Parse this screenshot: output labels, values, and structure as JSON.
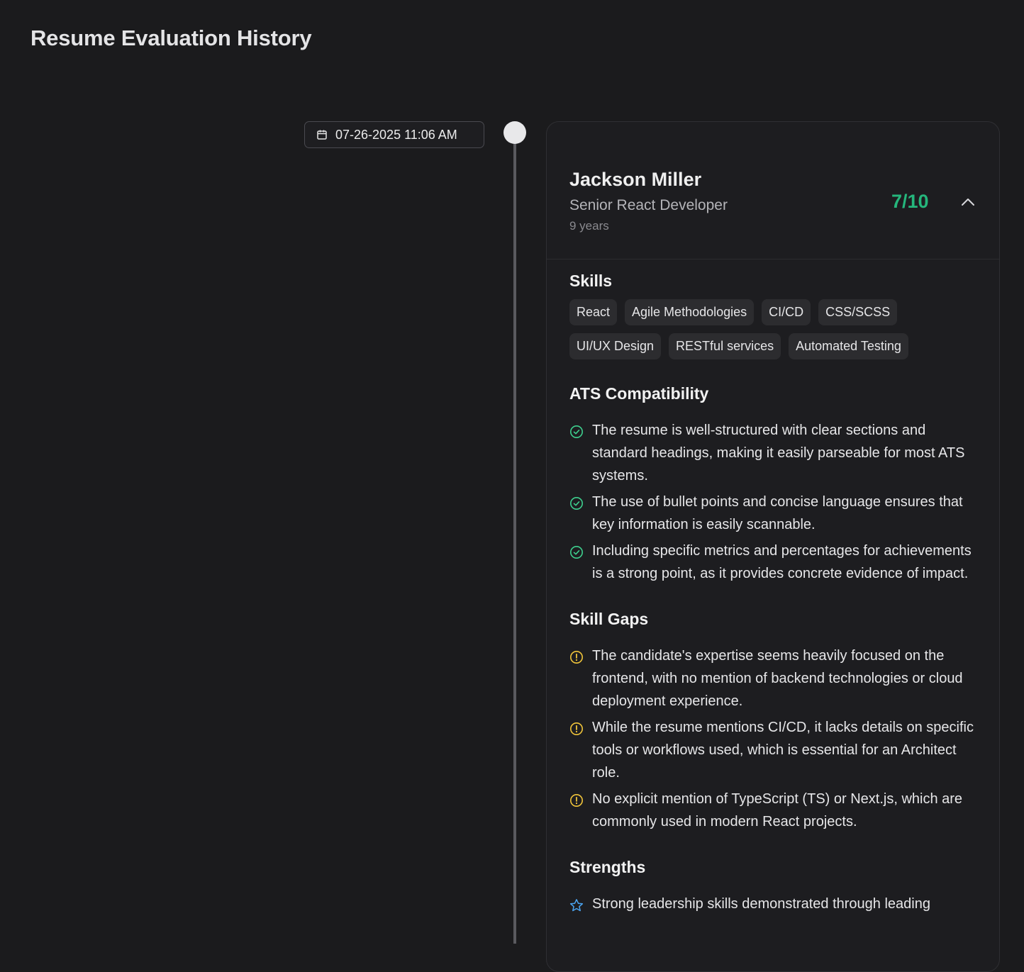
{
  "page": {
    "title": "Resume Evaluation History"
  },
  "entry": {
    "date": "07-26-2025 11:06 AM",
    "candidate": {
      "name": "Jackson Miller",
      "role": "Senior React Developer",
      "experience": "9 years",
      "score": "7/10"
    },
    "skills": {
      "title": "Skills",
      "items": [
        "React",
        "Agile Methodologies",
        "CI/CD",
        "CSS/SCSS",
        "UI/UX Design",
        "RESTful services",
        "Automated Testing"
      ]
    },
    "ats": {
      "title": "ATS Compatibility",
      "items": [
        "The resume is well-structured with clear sections and standard headings, making it easily parseable for most ATS systems.",
        "The use of bullet points and concise language ensures that key information is easily scannable.",
        "Including specific metrics and percentages for achievements is a strong point, as it provides concrete evidence of impact."
      ]
    },
    "gaps": {
      "title": "Skill Gaps",
      "items": [
        "The candidate's expertise seems heavily focused on the frontend, with no mention of backend technologies or cloud deployment experience.",
        "While the resume mentions CI/CD, it lacks details on specific tools or workflows used, which is essential for an Architect role.",
        "No explicit mention of TypeScript (TS) or Next.js, which are commonly used in modern React projects."
      ]
    },
    "strengths": {
      "title": "Strengths",
      "items": [
        "Strong leadership skills demonstrated through leading"
      ]
    }
  },
  "colors": {
    "background": "#1b1b1d",
    "score": "#25b67c",
    "check_icon": "#3ecf8e",
    "alert_icon": "#f0c43a",
    "star_icon": "#4aa3f0"
  },
  "icons": {
    "date": "calendar-icon",
    "collapse": "chevron-up-icon",
    "ats": "check-circle-icon",
    "gaps": "alert-circle-icon",
    "strengths": "star-icon"
  }
}
